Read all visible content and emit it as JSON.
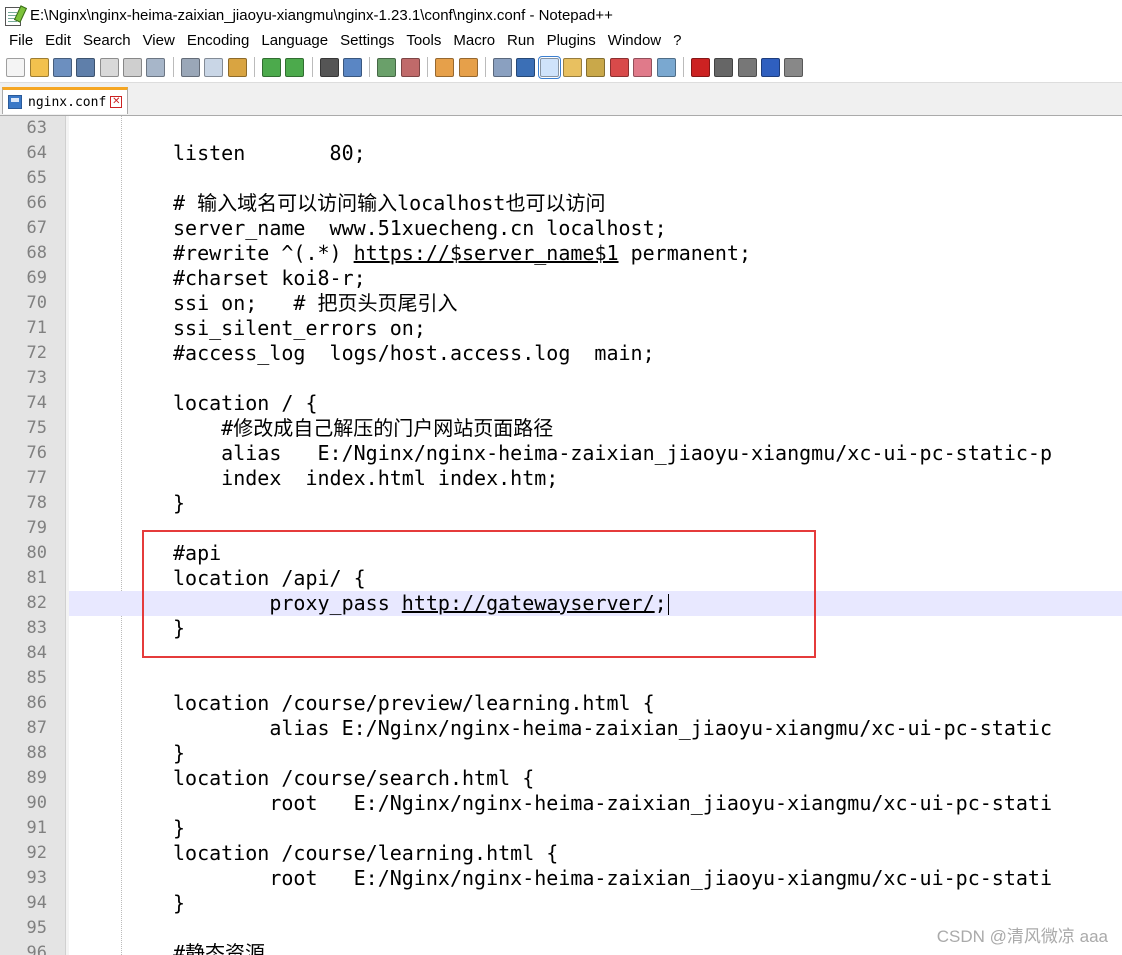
{
  "window": {
    "title": "E:\\Nginx\\nginx-heima-zaixian_jiaoyu-xiangmu\\nginx-1.23.1\\conf\\nginx.conf - Notepad++"
  },
  "menu": [
    "File",
    "Edit",
    "Search",
    "View",
    "Encoding",
    "Language",
    "Settings",
    "Tools",
    "Macro",
    "Run",
    "Plugins",
    "Window",
    "?"
  ],
  "toolbar_icons": [
    {
      "name": "new-icon",
      "color": "#f4f4f4"
    },
    {
      "name": "open-icon",
      "color": "#f2c14e"
    },
    {
      "name": "save-icon",
      "color": "#6c8fbf"
    },
    {
      "name": "save-all-icon",
      "color": "#5f7faa"
    },
    {
      "name": "close-icon",
      "color": "#d9d9d9"
    },
    {
      "name": "close-all-icon",
      "color": "#cfcfcf"
    },
    {
      "name": "print-icon",
      "color": "#a7b6c9"
    },
    {
      "sep": true
    },
    {
      "name": "cut-icon",
      "color": "#9aa7b8"
    },
    {
      "name": "copy-icon",
      "color": "#c9d6e6"
    },
    {
      "name": "paste-icon",
      "color": "#d9a441"
    },
    {
      "sep": true
    },
    {
      "name": "undo-icon",
      "color": "#4caa4c"
    },
    {
      "name": "redo-icon",
      "color": "#4caa4c"
    },
    {
      "sep": true
    },
    {
      "name": "find-icon",
      "color": "#555555"
    },
    {
      "name": "replace-icon",
      "color": "#5a86c4"
    },
    {
      "sep": true
    },
    {
      "name": "zoom-in-icon",
      "color": "#6aa06a"
    },
    {
      "name": "zoom-out-icon",
      "color": "#c06a6a"
    },
    {
      "sep": true
    },
    {
      "name": "sync-vertical-icon",
      "color": "#e6a04a"
    },
    {
      "name": "sync-horizontal-icon",
      "color": "#e6a04a"
    },
    {
      "sep": true
    },
    {
      "name": "word-wrap-icon",
      "color": "#8aa0c0"
    },
    {
      "name": "show-all-chars-icon",
      "color": "#3b6fb6"
    },
    {
      "name": "indent-guide-icon",
      "color": "#5a86c4",
      "selected": true
    },
    {
      "name": "doc-map-icon",
      "color": "#e8c060"
    },
    {
      "name": "function-list-icon",
      "color": "#c9a84a"
    },
    {
      "name": "folder-workspace-icon",
      "color": "#d84a4a"
    },
    {
      "name": "doc-list-icon",
      "color": "#e07a8a"
    },
    {
      "name": "monitor-icon",
      "color": "#7aa8d0"
    },
    {
      "sep": true
    },
    {
      "name": "record-macro-icon",
      "color": "#cc2222"
    },
    {
      "name": "stop-macro-icon",
      "color": "#666666"
    },
    {
      "name": "play-macro-icon",
      "color": "#777777"
    },
    {
      "name": "run-macro-multiple-icon",
      "color": "#2f5fbf"
    },
    {
      "name": "save-macro-icon",
      "color": "#888888"
    }
  ],
  "tab": {
    "label": "nginx.conf"
  },
  "lines": [
    {
      "n": "63",
      "text": ""
    },
    {
      "n": "64",
      "text": "listen       80;"
    },
    {
      "n": "65",
      "text": ""
    },
    {
      "n": "66",
      "text": "# 输入域名可以访问输入localhost也可以访问"
    },
    {
      "n": "67",
      "text": "server_name  www.51xuecheng.cn localhost;"
    },
    {
      "n": "68",
      "pre": "#rewrite ^(.*) ",
      "link": "https://$server_name$1",
      "post": " permanent;"
    },
    {
      "n": "69",
      "text": "#charset koi8-r;"
    },
    {
      "n": "70",
      "text": "ssi on;   # 把页头页尾引入"
    },
    {
      "n": "71",
      "text": "ssi_silent_errors on;"
    },
    {
      "n": "72",
      "text": "#access_log  logs/host.access.log  main;"
    },
    {
      "n": "73",
      "text": ""
    },
    {
      "n": "74",
      "text": "location / {"
    },
    {
      "n": "75",
      "text": "    #修改成自己解压的门户网站页面路径"
    },
    {
      "n": "76",
      "text": "    alias   E:/Nginx/nginx-heima-zaixian_jiaoyu-xiangmu/xc-ui-pc-static-p"
    },
    {
      "n": "77",
      "text": "    index  index.html index.htm;"
    },
    {
      "n": "78",
      "text": "}"
    },
    {
      "n": "79",
      "text": ""
    },
    {
      "n": "80",
      "text": "#api"
    },
    {
      "n": "81",
      "text": "location /api/ {"
    },
    {
      "n": "82",
      "pre": "        proxy_pass ",
      "link": "http://gatewayserver/",
      "post": ";",
      "current": true
    },
    {
      "n": "83",
      "text": "}"
    },
    {
      "n": "84",
      "text": ""
    },
    {
      "n": "85",
      "text": ""
    },
    {
      "n": "86",
      "text": "location /course/preview/learning.html {"
    },
    {
      "n": "87",
      "text": "        alias E:/Nginx/nginx-heima-zaixian_jiaoyu-xiangmu/xc-ui-pc-static"
    },
    {
      "n": "88",
      "text": "}"
    },
    {
      "n": "89",
      "text": "location /course/search.html {"
    },
    {
      "n": "90",
      "text": "        root   E:/Nginx/nginx-heima-zaixian_jiaoyu-xiangmu/xc-ui-pc-stati"
    },
    {
      "n": "91",
      "text": "}"
    },
    {
      "n": "92",
      "text": "location /course/learning.html {"
    },
    {
      "n": "93",
      "text": "        root   E:/Nginx/nginx-heima-zaixian_jiaoyu-xiangmu/xc-ui-pc-stati"
    },
    {
      "n": "94",
      "text": "}"
    },
    {
      "n": "95",
      "text": ""
    },
    {
      "n": "96",
      "text": "#静态资源"
    }
  ],
  "watermark": "CSDN @清风微凉 aaa"
}
